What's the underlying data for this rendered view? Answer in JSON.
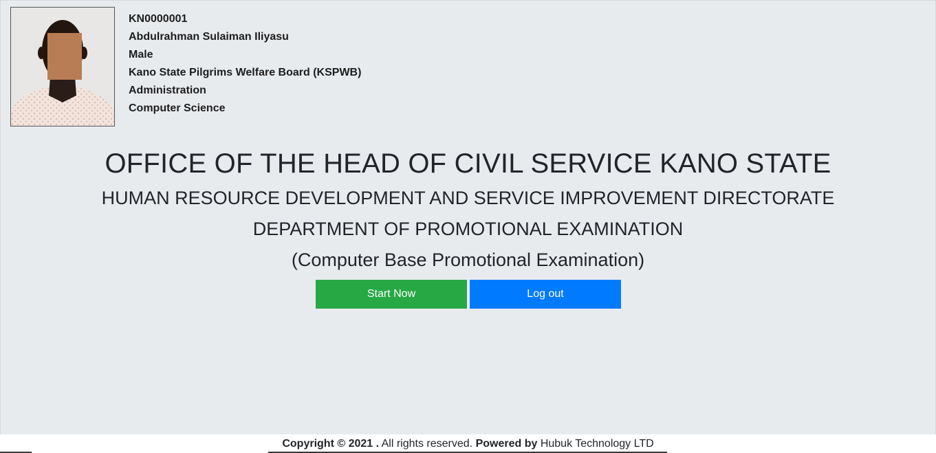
{
  "profile": {
    "id": "KN0000001",
    "name": "Abdulrahman Sulaiman Iliyasu",
    "gender": "Male",
    "organization": "Kano State Pilgrims Welfare Board (KSPWB)",
    "department": "Administration",
    "field": "Computer Science"
  },
  "headings": {
    "main": "OFFICE OF THE HEAD OF CIVIL SERVICE KANO STATE",
    "sub1": "HUMAN RESOURCE DEVELOPMENT AND SERVICE IMPROVEMENT DIRECTORATE",
    "sub2": "DEPARTMENT OF PROMOTIONAL EXAMINATION",
    "sub3": "(Computer Base Promotional Examination)"
  },
  "buttons": {
    "start": "Start Now",
    "logout": "Log out"
  },
  "footer": {
    "copyright": "Copyright © 2021 .",
    "rights": " All rights reserved. ",
    "powered_by": "Powered by",
    "company": " Hubuk Technology LTD"
  },
  "colors": {
    "background": "#e8ebee",
    "start_button": "#28a745",
    "logout_button": "#007bff",
    "face_blur": "#b97d56"
  },
  "icons": {
    "photo": "profile-photo"
  }
}
